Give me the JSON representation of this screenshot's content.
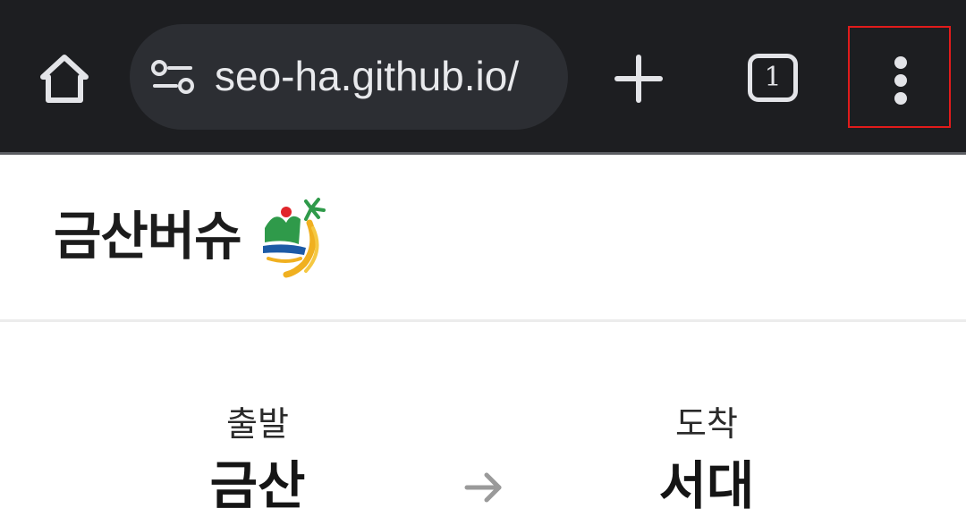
{
  "browser": {
    "url": "seo-ha.github.io/",
    "tab_count": "1",
    "icons": {
      "home": "home-icon",
      "site_info": "site-info-icon",
      "new_tab": "plus-icon",
      "tabs": "tab-switcher-icon",
      "menu": "more-vert-icon"
    },
    "highlight_color": "#e11b1b"
  },
  "page": {
    "title": "금산버슈",
    "logo": "geumsan-logo",
    "route": {
      "origin_label": "출발",
      "origin_value": "금산",
      "destination_label": "도착",
      "destination_value": "서대",
      "arrow_icon": "arrow-right-icon"
    }
  }
}
